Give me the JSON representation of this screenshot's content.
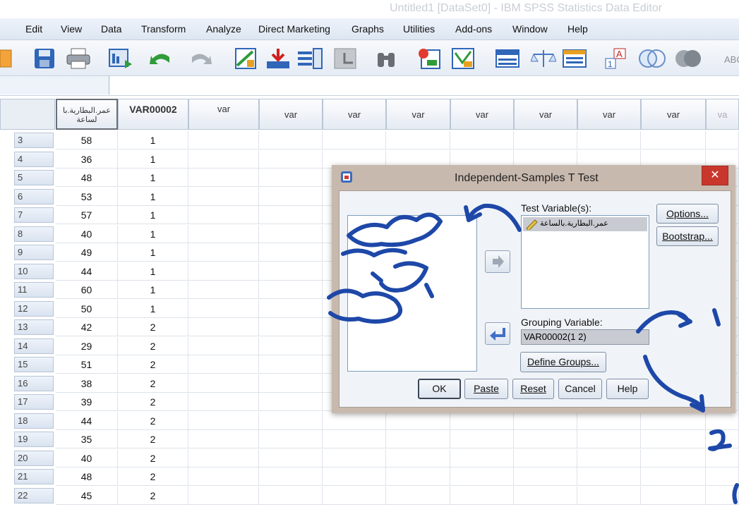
{
  "window": {
    "title": "Untitled1 [DataSet0] - IBM SPSS Statistics Data Editor"
  },
  "menu": [
    "Edit",
    "View",
    "Data",
    "Transform",
    "Analyze",
    "Direct Marketing",
    "Graphs",
    "Utilities",
    "Add-ons",
    "Window",
    "Help"
  ],
  "grid": {
    "columns": [
      "عمر.البطارية.با لساعة",
      "VAR00002",
      "var",
      "var",
      "var",
      "var",
      "var",
      "var",
      "var",
      "var"
    ],
    "col1_line1": "عمر.البطارية.با",
    "col1_line2": "لساعة",
    "rows": [
      {
        "n": "3",
        "a": "58",
        "b": "1"
      },
      {
        "n": "4",
        "a": "36",
        "b": "1"
      },
      {
        "n": "5",
        "a": "48",
        "b": "1"
      },
      {
        "n": "6",
        "a": "53",
        "b": "1"
      },
      {
        "n": "7",
        "a": "57",
        "b": "1"
      },
      {
        "n": "8",
        "a": "40",
        "b": "1"
      },
      {
        "n": "9",
        "a": "49",
        "b": "1"
      },
      {
        "n": "10",
        "a": "44",
        "b": "1"
      },
      {
        "n": "11",
        "a": "60",
        "b": "1"
      },
      {
        "n": "12",
        "a": "50",
        "b": "1"
      },
      {
        "n": "13",
        "a": "42",
        "b": "2"
      },
      {
        "n": "14",
        "a": "29",
        "b": "2"
      },
      {
        "n": "15",
        "a": "51",
        "b": "2"
      },
      {
        "n": "16",
        "a": "38",
        "b": "2"
      },
      {
        "n": "17",
        "a": "39",
        "b": "2"
      },
      {
        "n": "18",
        "a": "44",
        "b": "2"
      },
      {
        "n": "19",
        "a": "35",
        "b": "2"
      },
      {
        "n": "20",
        "a": "40",
        "b": "2"
      },
      {
        "n": "21",
        "a": "48",
        "b": "2"
      },
      {
        "n": "22",
        "a": "45",
        "b": "2"
      }
    ]
  },
  "dialog": {
    "title": "Independent-Samples T Test",
    "close": "✕",
    "test_variables_label": "Test Variable(s):",
    "test_variable_item": "عمر.البطارية.بالساعة",
    "grouping_label": "Grouping Variable:",
    "grouping_value": "VAR00002(1 2)",
    "buttons": {
      "options": "Options...",
      "bootstrap": "Bootstrap...",
      "define_groups": "Define Groups...",
      "ok": "OK",
      "paste": "Paste",
      "reset": "Reset",
      "cancel": "Cancel",
      "help": "Help"
    }
  },
  "annotations": {
    "handwritten_1": "1",
    "handwritten_2": "2"
  },
  "colors": {
    "accent": "#1e48a8",
    "close_red": "#c9372c"
  }
}
